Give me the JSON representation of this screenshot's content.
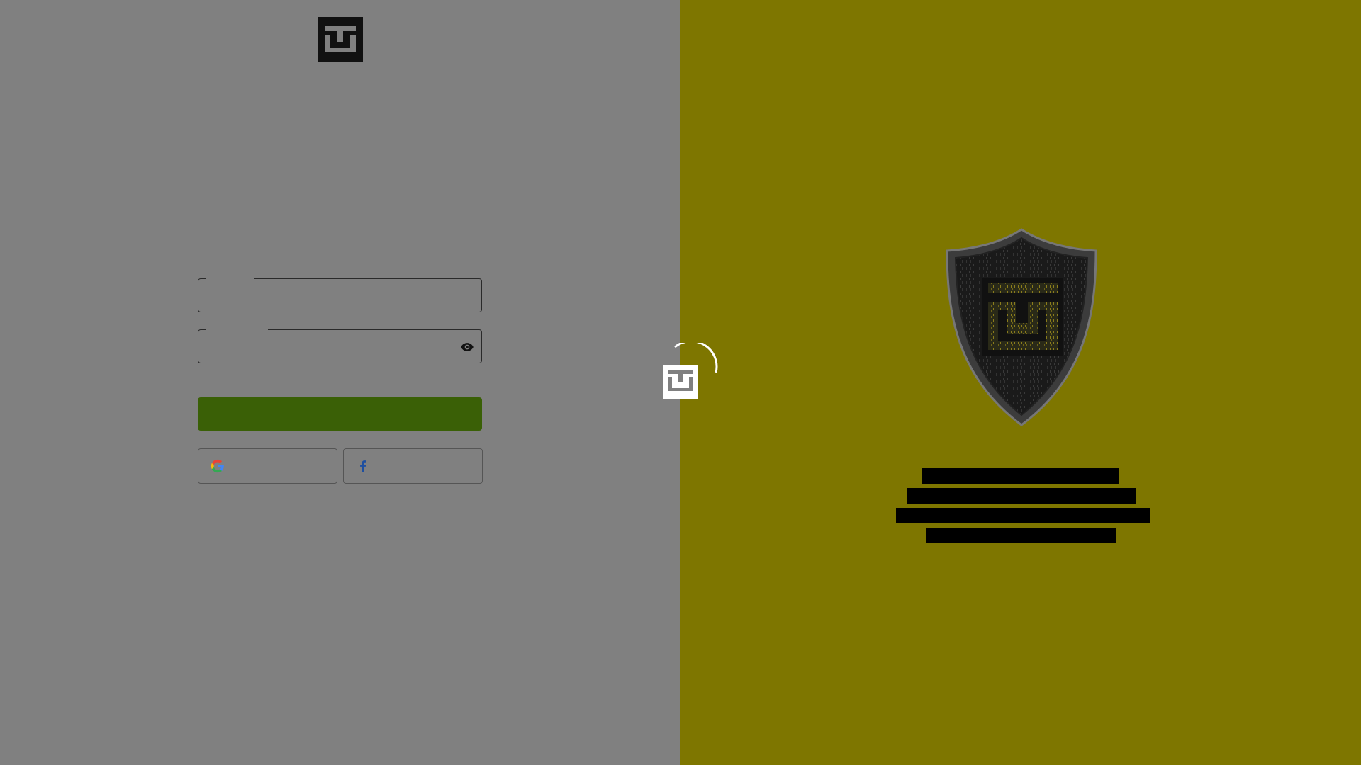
{
  "brand": {
    "logo_icon": "tt-logo-icon"
  },
  "login_form": {
    "username_label": "",
    "username_value": "",
    "password_label": "",
    "password_value": "",
    "password_toggle_icon": "eye-icon",
    "login_button_label": "",
    "google_button_label": "",
    "google_icon": "google-g-icon",
    "facebook_button_label": "",
    "facebook_icon": "facebook-f-icon",
    "signup_link_label": ""
  },
  "center": {
    "loader_icon": "tt-loader-icon"
  },
  "promo": {
    "shield_icon": "shield-icon",
    "lines": [
      "",
      "",
      "",
      ""
    ]
  },
  "colors": {
    "left_background": "#808080",
    "right_background": "#7e7600",
    "login_button": "#3a6006",
    "field_border": "#2a2a2a"
  }
}
